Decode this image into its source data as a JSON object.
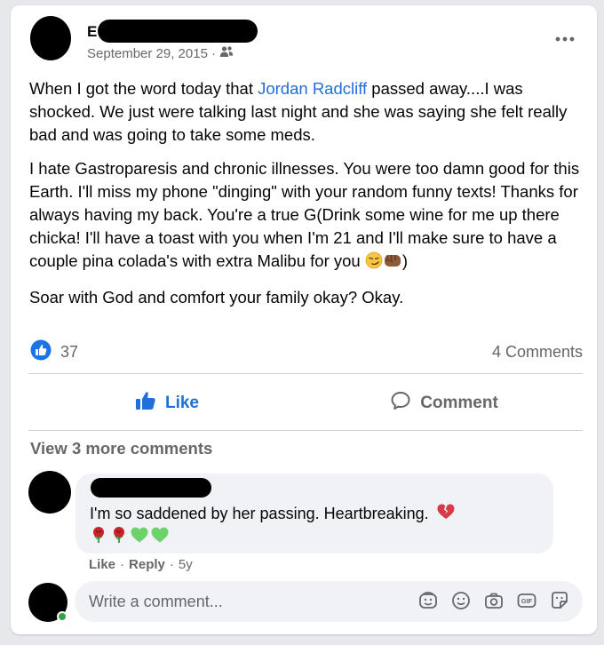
{
  "post": {
    "author_initial": "E",
    "date": "September 29, 2015",
    "date_separator": "·",
    "audience_icon": "friends-icon",
    "more_icon": "more-dots-icon",
    "body": {
      "p1_start": "When I got the word today that ",
      "mention": "Jordan Radcliff",
      "p1_end": " passed away....I was shocked. We just were talking last night and she was saying she felt really bad and was going to take some meds.",
      "p2": "I hate Gastroparesis and chronic illnesses. You were too damn good for this Earth. I'll miss my phone \"dinging\" with your random funny texts! Thanks for always having my back. You're a true G(Drink some wine for me up there chicka! I'll have a toast with you when I'm 21 and I'll make sure to have a couple pina colada's with extra Malibu for you ",
      "p2_end": ")",
      "p3": "Soar with God and comfort your family okay? Okay."
    }
  },
  "reactions": {
    "like_count": "37",
    "comments_count": "4 Comments",
    "icon": "like-reaction-icon"
  },
  "actions": {
    "like_label": "Like",
    "comment_label": "Comment"
  },
  "comments": {
    "view_more": "View 3 more comments",
    "items": [
      {
        "text": "I'm so saddened by her passing. Heartbreaking.",
        "like": "Like",
        "reply": "Reply",
        "time": "5y",
        "sep": "·"
      }
    ]
  },
  "composer": {
    "placeholder": "Write a comment...",
    "icons": [
      "avatar-sticker-icon",
      "emoji-icon",
      "camera-icon",
      "gif-icon",
      "sticker-icon"
    ]
  },
  "colors": {
    "accent": "#216fdb",
    "muted": "#65676b",
    "bubble": "#f0f2f5"
  }
}
